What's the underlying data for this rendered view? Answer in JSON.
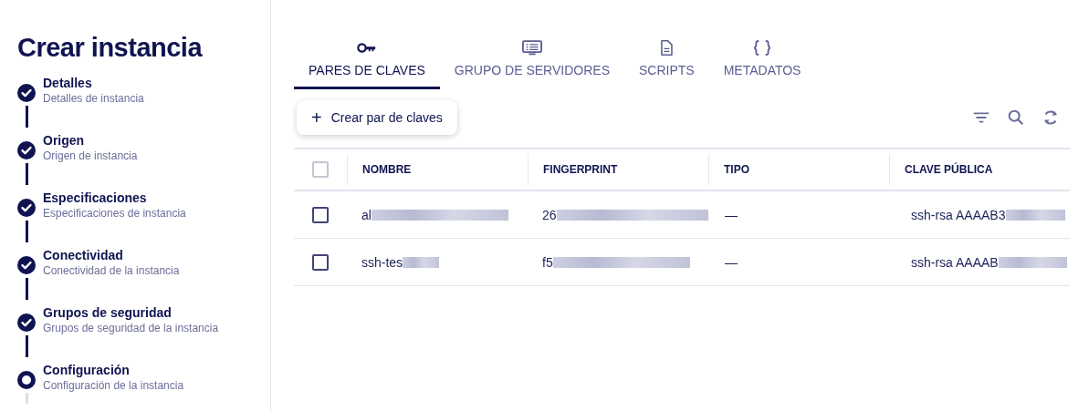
{
  "title": "Crear instancia",
  "steps": [
    {
      "name": "Detalles",
      "description": "Detalles de instancia",
      "done": true
    },
    {
      "name": "Origen",
      "description": "Origen de instancia",
      "done": true
    },
    {
      "name": "Especificaciones",
      "description": "Especificaciones de instancia",
      "done": true
    },
    {
      "name": "Conectividad",
      "description": "Conectividad de la instancia",
      "done": true
    },
    {
      "name": "Grupos de seguridad",
      "description": "Grupos de seguridad de la instancia",
      "done": true
    },
    {
      "name": "Configuración",
      "description": "Configuración de la instancia",
      "done": false
    }
  ],
  "tabs": [
    {
      "label": "PARES DE CLAVES",
      "kind": "key",
      "selected": true
    },
    {
      "label": "GRUPO DE SERVIDORES",
      "kind": "server",
      "selected": false
    },
    {
      "label": "SCRIPTS",
      "kind": "file",
      "selected": false
    },
    {
      "label": "METADATOS",
      "kind": "braces",
      "selected": false
    }
  ],
  "create_button": {
    "icon": "+",
    "label": "Crear par de claves"
  },
  "table": {
    "select_all_checked": false,
    "columns": [
      "NOMBRE",
      "FINGERPRINT",
      "TIPO",
      "CLAVE PÚBLICA"
    ],
    "rows": [
      {
        "checked": false,
        "cells": [
          "al",
          "26",
          "—",
          "ssh-rsa AAAAB3"
        ]
      },
      {
        "checked": false,
        "cells": [
          "ssh-tes",
          "f5",
          "—",
          "ssh-rsa AAAAB"
        ]
      }
    ]
  }
}
